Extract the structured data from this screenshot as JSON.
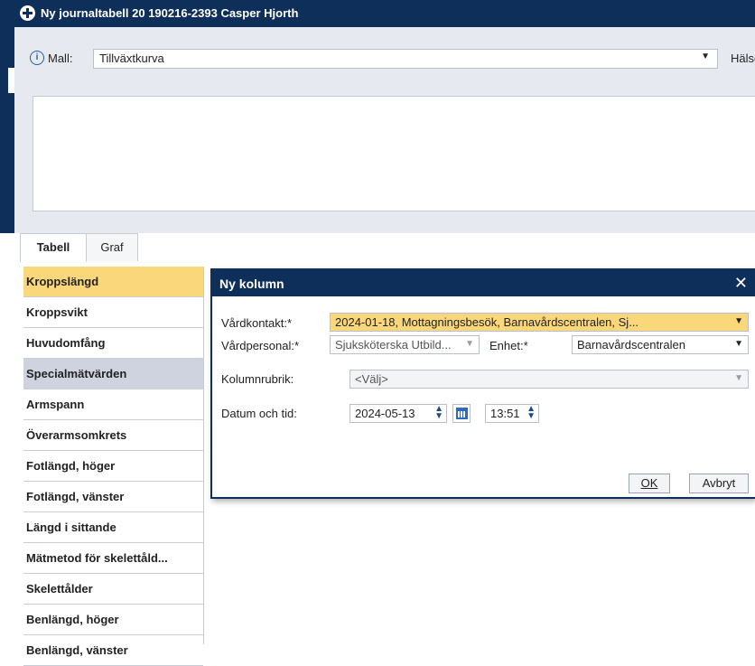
{
  "window": {
    "title": "Ny journaltabell 20 190216-2393 Casper Hjorth"
  },
  "mall": {
    "label": "Mall:",
    "value": "Tillväxtkurva",
    "right_label": "Hälsoåre"
  },
  "tabs": [
    {
      "label": "Tabell",
      "active": true
    },
    {
      "label": "Graf",
      "active": false
    }
  ],
  "sidebar": {
    "items": [
      {
        "label": "Kroppslängd"
      },
      {
        "label": "Kroppsvikt"
      },
      {
        "label": "Huvudomfång"
      },
      {
        "label": "Specialmätvärden"
      },
      {
        "label": "Armspann"
      },
      {
        "label": "Överarmsomkrets"
      },
      {
        "label": "Fotlängd, höger"
      },
      {
        "label": "Fotlängd, vänster"
      },
      {
        "label": "Längd i sittande"
      },
      {
        "label": "Mätmetod för skelettåld..."
      },
      {
        "label": "Skelettålder"
      },
      {
        "label": "Benlängd, höger"
      },
      {
        "label": "Benlängd, vänster"
      }
    ]
  },
  "dialog": {
    "title": "Ny kolumn",
    "close_glyph": "✕",
    "vardkontakt_label": "Vårdkontakt:*",
    "vardkontakt_value": "2024-01-18, Mottagningsbesök, Barnavårdscentralen, Sj...",
    "vardpersonal_label": "Vårdpersonal:*",
    "vardpersonal_value": "Sjuksköterska Utbild...",
    "enhet_label": "Enhet:*",
    "enhet_value": "Barnavårdscentralen",
    "kolumnrubrik_label": "Kolumnrubrik:",
    "kolumnrubrik_value": "<Välj>",
    "datum_label": "Datum och tid:",
    "date_value": "2024-05-13",
    "time_value": "13:51",
    "ok_label": "OK",
    "cancel_label": "Avbryt"
  },
  "glyphs": {
    "dropdown_arrow": "▼",
    "spinner": "▲▼",
    "info": "i"
  },
  "colors": {
    "titlebar": "#0f2f5b",
    "highlight": "#fbd77c",
    "group_row": "#cfd3e0",
    "panel_bg": "#e6eaf0"
  }
}
